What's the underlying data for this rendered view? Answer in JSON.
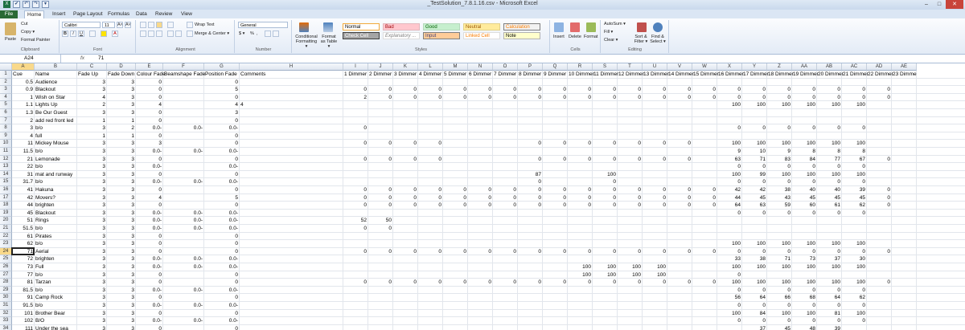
{
  "window": {
    "title": "_TestSolution_7.8.1.16.csv - Microsoft Excel",
    "quick_access": [
      "✔",
      "↶",
      "↷",
      "▾"
    ],
    "controls": [
      "–",
      "□",
      "✕"
    ]
  },
  "tabs": [
    "File",
    "Home",
    "Insert",
    "Page Layout",
    "Formulas",
    "Data",
    "Review",
    "View"
  ],
  "ribbon": {
    "clipboard": {
      "label": "Clipboard",
      "paste": "Paste",
      "cut": "Cut",
      "copy": "Copy ▾",
      "format_painter": "Format Painter"
    },
    "font": {
      "label": "Font",
      "font_name": "Calibri",
      "font_size": "11",
      "grow": "A˄",
      "shrink": "A˅",
      "bold": "B",
      "italic": "I",
      "underline": "U"
    },
    "alignment": {
      "label": "Alignment",
      "wrap_text": "Wrap Text",
      "merge_center": "Merge & Center ▾"
    },
    "number": {
      "label": "Number",
      "format": "General",
      "currency": "$ ▾",
      "percent": "%",
      "comma": ","
    },
    "styles": {
      "label": "Styles",
      "conditional": "Conditional Formatting ▾",
      "format_table": "Format as Table ▾",
      "cells": [
        {
          "name": "Normal",
          "bg": "#ffffff",
          "fg": "#000000",
          "border": "#f2a93b"
        },
        {
          "name": "Bad",
          "bg": "#ffc7ce",
          "fg": "#9c0006",
          "border": "#e2b7bd"
        },
        {
          "name": "Good",
          "bg": "#c6efce",
          "fg": "#006100",
          "border": "#b5d9bc"
        },
        {
          "name": "Neutral",
          "bg": "#ffeb9c",
          "fg": "#9c5700",
          "border": "#e3d18a"
        },
        {
          "name": "Calculation",
          "bg": "#f2f2f2",
          "fg": "#fa7d00",
          "border": "#7f7f7f"
        },
        {
          "name": "Check Cell",
          "bg": "#a5a5a5",
          "fg": "#ffffff",
          "border": "#3f3f3f"
        },
        {
          "name": "Explanatory ...",
          "bg": "#ffffff",
          "fg": "#7f7f7f",
          "border": "#dddddd"
        },
        {
          "name": "Input",
          "bg": "#ffcc99",
          "fg": "#3f3f76",
          "border": "#7f7f7f"
        },
        {
          "name": "Linked Cell",
          "bg": "#ffffff",
          "fg": "#fa7d00",
          "border": "#dddddd"
        },
        {
          "name": "Note",
          "bg": "#ffffcc",
          "fg": "#000000",
          "border": "#b2b2b2"
        }
      ]
    },
    "cells": {
      "label": "Cells",
      "insert": "Insert",
      "delete": "Delete",
      "format": "Format"
    },
    "editing": {
      "label": "Editing",
      "autosum": "AutoSum ▾",
      "fill": "Fill ▾",
      "clear": "Clear ▾",
      "sort_filter": "Sort & Filter ▾",
      "find_select": "Find & Select ▾"
    }
  },
  "formula_bar": {
    "cell_ref": "A24",
    "fx": "fx",
    "value": "71"
  },
  "columns": [
    "A",
    "B",
    "C",
    "D",
    "E",
    "F",
    "G",
    "H",
    "I",
    "J",
    "K",
    "L",
    "M",
    "N",
    "O",
    "P",
    "Q",
    "R",
    "S",
    "T",
    "U",
    "V",
    "W",
    "X",
    "Y",
    "Z",
    "AA",
    "AB",
    "AC",
    "AD",
    "AE"
  ],
  "selected_cell": {
    "row": 24,
    "col": "A"
  },
  "rows": [
    {
      "n": 1,
      "cells": {
        "A": "Cue",
        "B": "Name",
        "C": "Fade Up",
        "D": "Fade Down",
        "E": "Colour Fade",
        "F": "Beamshape Fade",
        "G": "Position Fade",
        "H": "Comments",
        "I": "1 Dimmer",
        "J": "2 Dimmer",
        "K": "3 Dimmer",
        "L": "4 Dimmer",
        "M": "5 Dimmer",
        "N": "6 Dimmer",
        "O": "7 Dimmer",
        "P": "8 Dimmer",
        "Q": "9 Dimmer",
        "R": "10 Dimmer",
        "S": "11 Dimmer",
        "T": "12 Dimmer",
        "U": "13 Dimmer",
        "V": "14 Dimmer",
        "W": "15 Dimmer",
        "X": "16 Dimmer",
        "Y": "17 Dimmer",
        "Z": "18 Dimmer",
        "AA": "19 Dimmer",
        "AB": "20 Dimmer",
        "AC": "21 Dimmer",
        "AD": "22 Dimmer",
        "AE": "23 Dimme"
      }
    },
    {
      "n": 2,
      "cells": {
        "A": "0.5",
        "B": "Audience",
        "C": "3",
        "D": "3",
        "E": "0",
        "F": "",
        "G": "0"
      }
    },
    {
      "n": 3,
      "cells": {
        "A": "0.9",
        "B": "Blackout",
        "C": "3",
        "D": "3",
        "E": "0",
        "F": "",
        "G": "5",
        "I": "0",
        "J": "0",
        "K": "0",
        "L": "0",
        "M": "0",
        "N": "0",
        "O": "0",
        "P": "0",
        "Q": "0",
        "R": "0",
        "S": "0",
        "T": "0",
        "U": "0",
        "V": "0",
        "W": "0",
        "X": "0",
        "Y": "0",
        "Z": "0",
        "AA": "0",
        "AB": "0",
        "AC": "0",
        "AD": "0"
      }
    },
    {
      "n": 4,
      "cells": {
        "A": "1",
        "B": "Wish on Star",
        "C": "4",
        "D": "3",
        "E": "0",
        "F": "",
        "G": "0",
        "I": "2",
        "J": "0",
        "K": "0",
        "L": "0",
        "M": "0",
        "N": "0",
        "O": "0",
        "P": "0",
        "Q": "0",
        "R": "0",
        "S": "0",
        "T": "0",
        "U": "0",
        "V": "0",
        "W": "0",
        "X": "0",
        "Y": "0",
        "Z": "0",
        "AA": "0",
        "AB": "0",
        "AC": "0",
        "AD": "0"
      }
    },
    {
      "n": 5,
      "cells": {
        "A": "1.1",
        "B": "Lights Up",
        "C": "2",
        "D": "3",
        "E": "4",
        "F": "",
        "G": "4",
        "H": "4",
        "X": "100",
        "Y": "100",
        "Z": "100",
        "AA": "100",
        "AB": "100",
        "AC": "100"
      }
    },
    {
      "n": 6,
      "cells": {
        "A": "1.3",
        "B": "Be Our Guest",
        "C": "3",
        "D": "3",
        "E": "0",
        "F": "",
        "G": "3"
      }
    },
    {
      "n": 7,
      "cells": {
        "A": "2",
        "B": "add red front led",
        "C": "1",
        "D": "1",
        "E": "0",
        "F": "",
        "G": "0"
      }
    },
    {
      "n": 8,
      "cells": {
        "A": "3",
        "B": "b/o",
        "C": "3",
        "D": "2",
        "E": "0.0-",
        "F": "0.0-",
        "G": "0.0-",
        "I": "0",
        "X": "0",
        "Y": "0",
        "Z": "0",
        "AA": "0",
        "AB": "0",
        "AC": "0"
      }
    },
    {
      "n": 9,
      "cells": {
        "A": "4",
        "B": "full",
        "C": "1",
        "D": "1",
        "E": "0",
        "F": "",
        "G": "0"
      }
    },
    {
      "n": 10,
      "cells": {
        "A": "11",
        "B": "Mickey Mouse",
        "C": "3",
        "D": "3",
        "E": "3",
        "F": "",
        "G": "0",
        "I": "0",
        "J": "0",
        "K": "0",
        "L": "0",
        "P": "0",
        "Q": "0",
        "R": "0",
        "S": "0",
        "T": "0",
        "U": "0",
        "V": "0",
        "X": "100",
        "Y": "100",
        "Z": "100",
        "AA": "100",
        "AB": "100",
        "AC": "100"
      }
    },
    {
      "n": 11,
      "cells": {
        "A": "11.5",
        "B": "b/o",
        "C": "3",
        "D": "3",
        "E": "0.0-",
        "F": "0.0-",
        "G": "0.0-",
        "X": "9",
        "Y": "10",
        "Z": "9",
        "AA": "8",
        "AB": "8",
        "AC": "8"
      }
    },
    {
      "n": 12,
      "cells": {
        "A": "21",
        "B": "Lemonade",
        "C": "3",
        "D": "3",
        "E": "0",
        "F": "",
        "G": "0",
        "I": "0",
        "J": "0",
        "K": "0",
        "L": "0",
        "P": "0",
        "Q": "0",
        "R": "0",
        "S": "0",
        "T": "0",
        "U": "0",
        "V": "0",
        "X": "63",
        "Y": "71",
        "Z": "83",
        "AA": "84",
        "AB": "77",
        "AC": "67",
        "AD": "0"
      }
    },
    {
      "n": 13,
      "cells": {
        "A": "22",
        "B": "b/o",
        "C": "3",
        "D": "3",
        "E": "0.0-",
        "F": "",
        "G": "0.0-",
        "X": "0",
        "Y": "0",
        "Z": "0",
        "AA": "0",
        "AB": "0",
        "AC": "0"
      }
    },
    {
      "n": 14,
      "cells": {
        "A": "31",
        "B": "mat and runway",
        "C": "3",
        "D": "3",
        "E": "0",
        "F": "",
        "G": "0",
        "P": "87",
        "S": "100",
        "X": "100",
        "Y": "99",
        "Z": "100",
        "AA": "100",
        "AB": "100",
        "AC": "100"
      }
    },
    {
      "n": 15,
      "cells": {
        "A": "31.7",
        "B": "b/o",
        "C": "3",
        "D": "3",
        "E": "0.0-",
        "F": "0.0-",
        "G": "0.0-",
        "P": "0",
        "S": "0",
        "X": "0",
        "Y": "0",
        "Z": "0",
        "AA": "0",
        "AB": "0",
        "AC": "0"
      }
    },
    {
      "n": 16,
      "cells": {
        "A": "41",
        "B": "Hakuna",
        "C": "3",
        "D": "3",
        "E": "0",
        "F": "",
        "G": "0",
        "I": "0",
        "J": "0",
        "K": "0",
        "L": "0",
        "M": "0",
        "N": "0",
        "O": "0",
        "P": "0",
        "Q": "0",
        "R": "0",
        "S": "0",
        "T": "0",
        "U": "0",
        "V": "0",
        "W": "0",
        "X": "42",
        "Y": "42",
        "Z": "38",
        "AA": "40",
        "AB": "40",
        "AC": "39",
        "AD": "0"
      }
    },
    {
      "n": 17,
      "cells": {
        "A": "42",
        "B": "Movers?",
        "C": "3",
        "D": "3",
        "E": "4",
        "F": "",
        "G": "5",
        "I": "0",
        "J": "0",
        "K": "0",
        "L": "0",
        "M": "0",
        "N": "0",
        "O": "0",
        "P": "0",
        "Q": "0",
        "R": "0",
        "S": "0",
        "T": "0",
        "U": "0",
        "V": "0",
        "W": "0",
        "X": "44",
        "Y": "45",
        "Z": "43",
        "AA": "45",
        "AB": "45",
        "AC": "45",
        "AD": "0"
      }
    },
    {
      "n": 18,
      "cells": {
        "A": "44",
        "B": "brighten",
        "C": "3",
        "D": "3",
        "E": "0",
        "F": "",
        "G": "0",
        "I": "0",
        "J": "0",
        "K": "0",
        "L": "0",
        "M": "0",
        "N": "0",
        "O": "0",
        "P": "0",
        "Q": "0",
        "R": "0",
        "S": "0",
        "T": "0",
        "U": "0",
        "V": "0",
        "W": "0",
        "X": "64",
        "Y": "63",
        "Z": "59",
        "AA": "60",
        "AB": "61",
        "AC": "62",
        "AD": "0"
      }
    },
    {
      "n": 19,
      "cells": {
        "A": "45",
        "B": "Blackout",
        "C": "3",
        "D": "3",
        "E": "0.0-",
        "F": "0.0-",
        "G": "0.0-",
        "X": "0",
        "Y": "0",
        "Z": "0",
        "AA": "0",
        "AB": "0",
        "AC": "0"
      }
    },
    {
      "n": 20,
      "cells": {
        "A": "51",
        "B": "Rings",
        "C": "3",
        "D": "3",
        "E": "0.0-",
        "F": "0.0-",
        "G": "0.0-",
        "I": "52",
        "J": "50"
      }
    },
    {
      "n": 21,
      "cells": {
        "A": "51.5",
        "B": "b/o",
        "C": "3",
        "D": "3",
        "E": "0.0-",
        "F": "0.0-",
        "G": "0.0-",
        "I": "0",
        "J": "0"
      }
    },
    {
      "n": 22,
      "cells": {
        "A": "61",
        "B": "Pirates",
        "C": "3",
        "D": "3",
        "E": "0",
        "F": "",
        "G": "0"
      }
    },
    {
      "n": 23,
      "cells": {
        "A": "62",
        "B": "b/o",
        "C": "3",
        "D": "3",
        "E": "0",
        "F": "",
        "G": "0",
        "X": "100",
        "Y": "100",
        "Z": "100",
        "AA": "100",
        "AB": "100",
        "AC": "100"
      }
    },
    {
      "n": 24,
      "cells": {
        "A": "71",
        "B": "Aerial",
        "C": "3",
        "D": "3",
        "E": "0",
        "F": "",
        "G": "0",
        "I": "0",
        "J": "0",
        "K": "0",
        "L": "0",
        "M": "0",
        "N": "0",
        "O": "0",
        "P": "0",
        "Q": "0",
        "R": "0",
        "S": "0",
        "T": "0",
        "U": "0",
        "V": "0",
        "W": "0",
        "X": "0",
        "Y": "0",
        "Z": "0",
        "AA": "0",
        "AB": "0",
        "AC": "0",
        "AD": "0"
      }
    },
    {
      "n": 25,
      "cells": {
        "A": "72",
        "B": "brighten",
        "C": "3",
        "D": "3",
        "E": "0.0-",
        "F": "0.0-",
        "G": "0.0-",
        "X": "33",
        "Y": "38",
        "Z": "71",
        "AA": "73",
        "AB": "37",
        "AC": "30"
      }
    },
    {
      "n": 26,
      "cells": {
        "A": "73",
        "B": "Full",
        "C": "3",
        "D": "3",
        "E": "0.0-",
        "F": "0.0-",
        "G": "0.0-",
        "R": "100",
        "S": "100",
        "T": "100",
        "U": "100",
        "X": "100",
        "Y": "100",
        "Z": "100",
        "AA": "100",
        "AB": "100",
        "AC": "100"
      }
    },
    {
      "n": 27,
      "cells": {
        "A": "77",
        "B": "b/o",
        "C": "3",
        "D": "3",
        "E": "0",
        "F": "",
        "G": "0",
        "R": "100",
        "S": "100",
        "T": "100",
        "U": "100",
        "X": "0"
      }
    },
    {
      "n": 28,
      "cells": {
        "A": "81",
        "B": "Tarzan",
        "C": "3",
        "D": "3",
        "E": "0",
        "F": "",
        "G": "0",
        "I": "0",
        "J": "0",
        "K": "0",
        "L": "0",
        "M": "0",
        "N": "0",
        "O": "0",
        "P": "0",
        "Q": "0",
        "R": "0",
        "S": "0",
        "T": "0",
        "U": "0",
        "V": "0",
        "W": "0",
        "X": "100",
        "Y": "100",
        "Z": "100",
        "AA": "100",
        "AB": "100",
        "AC": "100",
        "AD": "0"
      }
    },
    {
      "n": 29,
      "cells": {
        "A": "81.5",
        "B": "b/o",
        "C": "3",
        "D": "3",
        "E": "0.0-",
        "F": "0.0-",
        "G": "0.0-",
        "X": "0",
        "Y": "0",
        "Z": "0",
        "AA": "0",
        "AB": "0",
        "AC": "0"
      }
    },
    {
      "n": 30,
      "cells": {
        "A": "91",
        "B": "Camp Rock",
        "C": "3",
        "D": "3",
        "E": "0",
        "F": "",
        "G": "0",
        "X": "56",
        "Y": "64",
        "Z": "66",
        "AA": "68",
        "AB": "64",
        "AC": "62"
      }
    },
    {
      "n": 31,
      "cells": {
        "A": "91.5",
        "B": "b/o",
        "C": "3",
        "D": "3",
        "E": "0.0-",
        "F": "0.0-",
        "G": "0.0-",
        "X": "0",
        "Y": "0",
        "Z": "0",
        "AA": "0",
        "AB": "0",
        "AC": "0"
      }
    },
    {
      "n": 32,
      "cells": {
        "A": "101",
        "B": "Brother Bear",
        "C": "3",
        "D": "3",
        "E": "0",
        "F": "",
        "G": "0",
        "X": "100",
        "Y": "84",
        "Z": "100",
        "AA": "100",
        "AB": "81",
        "AC": "100"
      }
    },
    {
      "n": 33,
      "cells": {
        "A": "102",
        "B": "B/O",
        "C": "3",
        "D": "3",
        "E": "0.0-",
        "F": "0.0-",
        "G": "0.0-",
        "X": "0",
        "Y": "0",
        "Z": "0",
        "AA": "0",
        "AB": "0",
        "AC": "0"
      }
    },
    {
      "n": 34,
      "cells": {
        "A": "111",
        "B": "Under the sea",
        "C": "3",
        "D": "3",
        "E": "0",
        "F": "",
        "G": "0",
        "Y": "37",
        "Z": "45",
        "AA": "48",
        "AB": "39"
      }
    }
  ]
}
